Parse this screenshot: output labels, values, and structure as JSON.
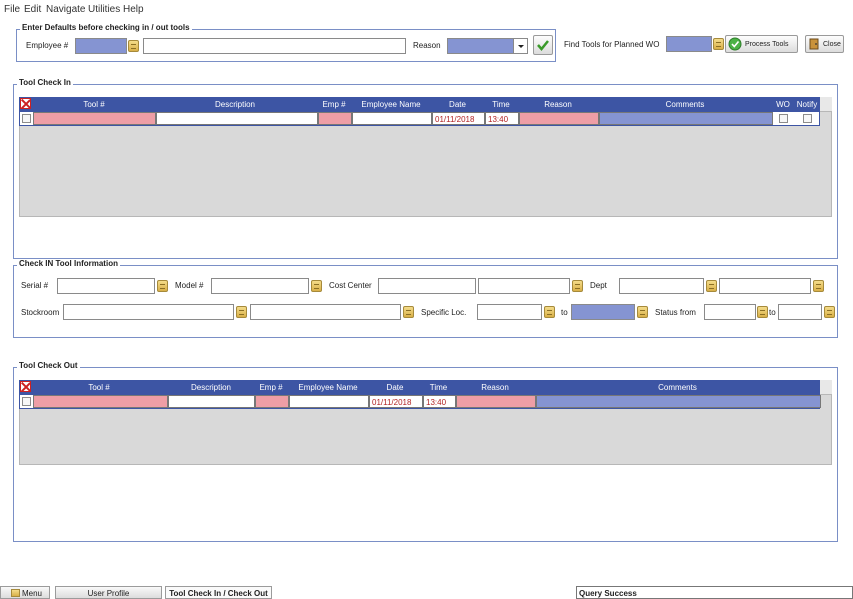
{
  "menu": [
    "File",
    "Edit",
    "Navigate",
    "Utilities",
    "Help"
  ],
  "defaults": {
    "legend": "Enter Defaults before checking in / out tools",
    "employee_label": "Employee #",
    "reason_label": "Reason",
    "find_label": "Find Tools for Planned WO",
    "process_label": "Process Tools",
    "close_label": "Close"
  },
  "checkin": {
    "legend": "Tool Check In",
    "headers": [
      "Tool #",
      "Description",
      "Emp #",
      "Employee Name",
      "Date",
      "Time",
      "Reason",
      "Comments",
      "WO",
      "Notify"
    ],
    "row": {
      "date": "01/11/2018",
      "time": "13:40"
    }
  },
  "info": {
    "legend": "Check IN Tool Information",
    "serial": "Serial #",
    "model": "Model #",
    "cost_center": "Cost Center",
    "dept": "Dept",
    "stockroom": "Stockroom",
    "specific_loc": "Specific Loc.",
    "to1": "to",
    "status_from": "Status from",
    "to2": "to"
  },
  "checkout": {
    "legend": "Tool Check Out",
    "headers": [
      "Tool #",
      "Description",
      "Emp #",
      "Employee Name",
      "Date",
      "Time",
      "Reason",
      "Comments"
    ],
    "row": {
      "date": "01/11/2018",
      "time": "13:40"
    }
  },
  "tabs": [
    "Menu",
    "User Profile",
    "Tool Check In / Check Out"
  ],
  "status": "Query Success",
  "icons": [
    "lookup-icon",
    "checkmark-icon",
    "delete-x-icon",
    "menu-icon"
  ]
}
